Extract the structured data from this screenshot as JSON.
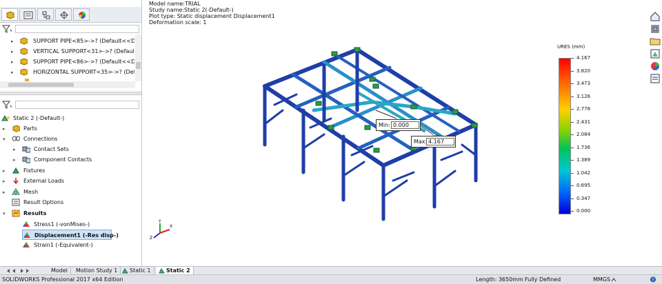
{
  "plot_info": {
    "model_name": "Model name:TRIAL",
    "study_name": "Study name:Static 2(-Default-)",
    "plot_type": "Plot type: Static displacement Displacement1",
    "deformation": "Deformation scale: 1"
  },
  "legend": {
    "title": "URES (mm)",
    "ticks": [
      "4.167",
      "3.820",
      "3.473",
      "3.126",
      "2.778",
      "2.431",
      "2.084",
      "1.736",
      "1.389",
      "1.042",
      "0.695",
      "0.347",
      "0.000"
    ]
  },
  "probes": {
    "min_label": "Min:",
    "min_value": "0.000",
    "max_label": "Max:",
    "max_value": "4.167"
  },
  "feature_tree_top": [
    "SUPPORT PIPE<85>->? (Default<<Defa",
    "VERTICAL SUPPORT<31>->? (Default<<",
    "SUPPORT PIPE<86>->? (Default<<Defa",
    "HORIZONTAL SUPPORT<35>->? (Defa"
  ],
  "study_tree": {
    "root": "Static 2 (-Default-)",
    "items": [
      "Parts",
      "Connections",
      "Contact Sets",
      "Component Contacts",
      "Fixtures",
      "External Loads",
      "Mesh",
      "Result Options",
      "Results",
      "Stress1 (-vonMises-)",
      "Displacement1 (-Res disp-)",
      "Strain1 (-Equivalent-)"
    ]
  },
  "bottom_tabs": [
    "Model",
    "Motion Study 1",
    "Static 1",
    "Static 2"
  ],
  "status": {
    "product": "SOLIDWORKS Professional 2017 x64 Edition",
    "length": "Length: 3650mm",
    "defined": "Fully Defined",
    "units": "MMGS"
  },
  "colors": {
    "accent": "#1f5fbf",
    "selection": "#cfe3f7",
    "structure_dark": "#1f3ea8",
    "structure_light": "#2aa6c6"
  }
}
